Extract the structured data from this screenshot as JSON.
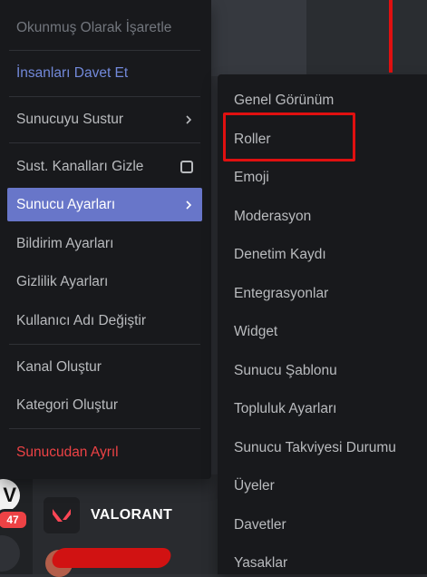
{
  "context_menu": {
    "items": [
      {
        "label": "Okunmuş Olarak İşaretle"
      },
      {
        "label": "İnsanları Davet Et"
      },
      {
        "label": "Sunucuyu Sustur"
      },
      {
        "label": "Sust. Kanalları Gizle"
      },
      {
        "label": "Sunucu Ayarları"
      },
      {
        "label": "Bildirim Ayarları"
      },
      {
        "label": "Gizlilik Ayarları"
      },
      {
        "label": "Kullanıcı Adı Değiştir"
      },
      {
        "label": "Kanal Oluştur"
      },
      {
        "label": "Kategori Oluştur"
      },
      {
        "label": "Sunucudan Ayrıl"
      }
    ]
  },
  "submenu": {
    "items": [
      {
        "label": "Genel Görünüm"
      },
      {
        "label": "Roller"
      },
      {
        "label": "Emoji"
      },
      {
        "label": "Moderasyon"
      },
      {
        "label": "Denetim Kaydı"
      },
      {
        "label": "Entegrasyonlar"
      },
      {
        "label": "Widget"
      },
      {
        "label": "Sunucu Şablonu"
      },
      {
        "label": "Topluluk Ayarları"
      },
      {
        "label": "Sunucu Takviyesi Durumu"
      },
      {
        "label": "Üyeler"
      },
      {
        "label": "Davetler"
      },
      {
        "label": "Yasaklar"
      }
    ]
  },
  "sidebar": {
    "server_icon_text": "V",
    "badge_count": "47"
  },
  "activity": {
    "game_name": "VALORANT"
  },
  "colors": {
    "accent": "#6876c9",
    "danger": "#ed4245",
    "link": "#7289da",
    "highlight_box": "#e01010"
  }
}
